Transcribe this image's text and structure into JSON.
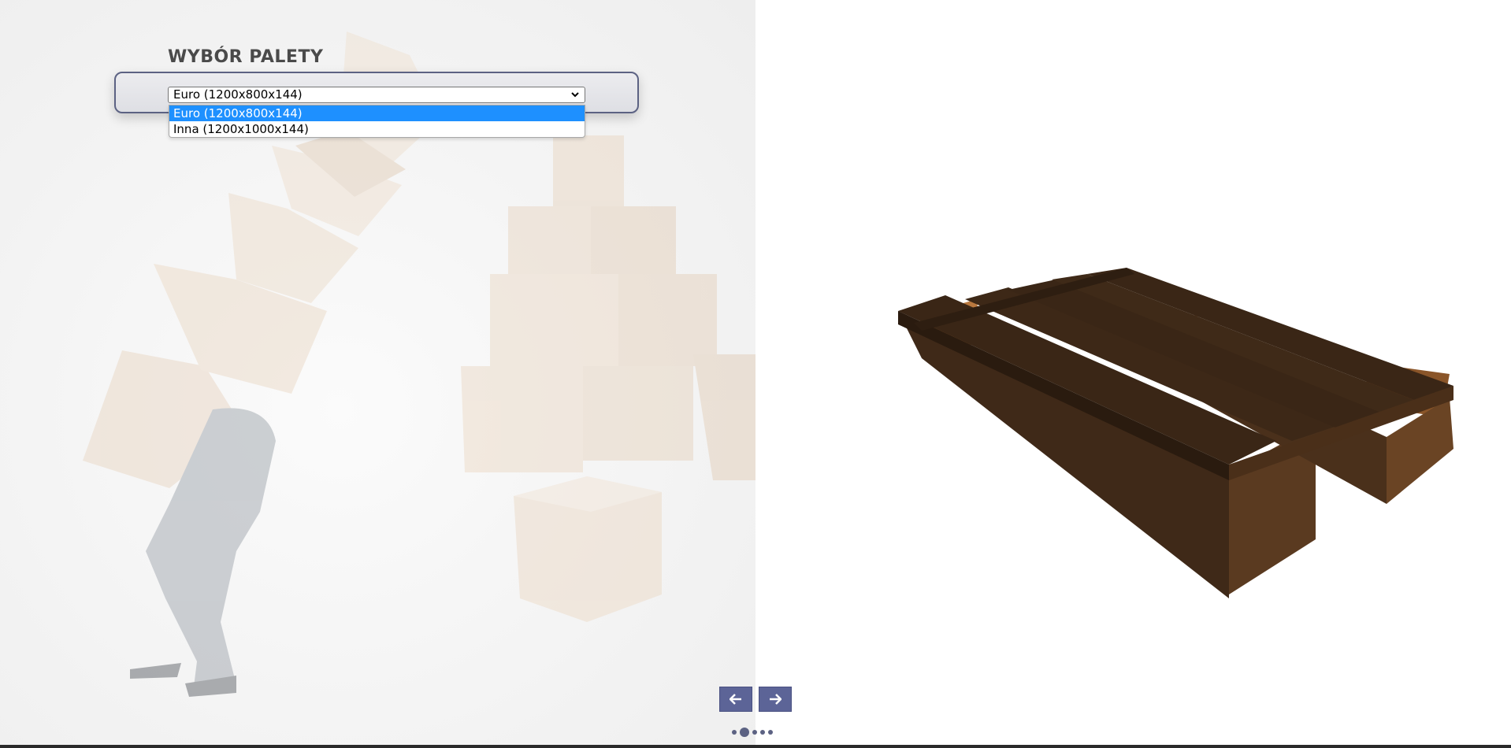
{
  "selector": {
    "title": "WYBÓR PALETY",
    "selected_value": "Euro (1200x800x144)",
    "options": [
      "Euro (1200x800x144)",
      "Inna (1200x1000x144)"
    ],
    "highlighted_index": 0
  },
  "navigation": {
    "prev_icon": "arrow-left-icon",
    "next_icon": "arrow-right-icon",
    "slide_count": 5,
    "active_slide": 2
  },
  "colors": {
    "accent": "#5c6497",
    "highlight": "#1e90ff",
    "wood_dark": "#3a2616",
    "wood_light": "#b9783f"
  }
}
